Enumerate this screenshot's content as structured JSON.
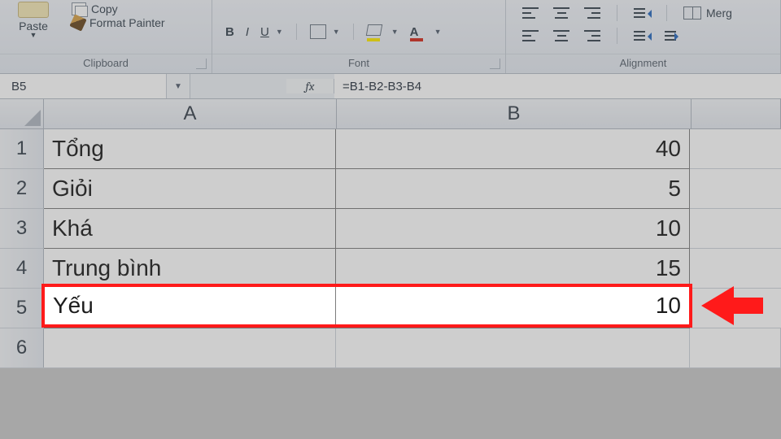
{
  "ribbon": {
    "paste_label": "Paste",
    "copy_label": "Copy",
    "format_painter_label": "Format Painter",
    "clipboard_title": "Clipboard",
    "font_title": "Font",
    "alignment_title": "Alignment",
    "bold": "B",
    "italic": "I",
    "underline": "U",
    "font_color_letter": "A",
    "merge_label": "Merg"
  },
  "formula_bar": {
    "name_box": "B5",
    "fx_label": "fx",
    "formula": "=B1-B2-B3-B4"
  },
  "columns": {
    "A": "A",
    "B": "B"
  },
  "rows": {
    "r1": {
      "n": "1",
      "A": "Tổng",
      "B": "40"
    },
    "r2": {
      "n": "2",
      "A": "Giỏi",
      "B": "5"
    },
    "r3": {
      "n": "3",
      "A": "Khá",
      "B": "10"
    },
    "r4": {
      "n": "4",
      "A": "Trung bình",
      "B": "15"
    },
    "r5": {
      "n": "5",
      "A": "Yếu",
      "B": "10"
    },
    "r6": {
      "n": "6",
      "A": "",
      "B": ""
    }
  }
}
